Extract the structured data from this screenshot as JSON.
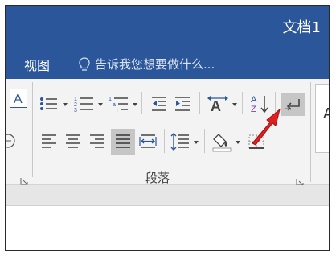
{
  "window": {
    "title": "文档1"
  },
  "tabs": {
    "view_label": "视图"
  },
  "tell_me": {
    "placeholder": "告诉我您想要做什么..."
  },
  "ribbon": {
    "paragraph_group_label": "段落",
    "style_preview_letter": "A"
  },
  "icons": {
    "bulb": "lightbulb-icon",
    "bullets": "bullets-icon",
    "numbering": "numbering-icon",
    "multilevel": "multilevel-list-icon",
    "decrease_indent": "decrease-indent-icon",
    "increase_indent": "increase-indent-icon",
    "char_scale": "character-scaling-icon",
    "sort": "sort-icon",
    "show_marks": "show-formatting-marks-icon",
    "align_left": "align-left-icon",
    "center": "align-center-icon",
    "align_right": "align-right-icon",
    "justify": "justify-icon",
    "distributed": "distributed-align-icon",
    "line_spacing": "line-spacing-icon",
    "shading": "shading-icon",
    "borders": "borders-icon",
    "red_pointer": "red-arrow-annotation"
  },
  "colors": {
    "ribbon_blue": "#2b579a",
    "ribbon_body": "#f3f3f3",
    "pressed_button": "#c6c6c6",
    "annotation_red": "#e02020"
  },
  "state": {
    "justify_pressed": true,
    "show_marks_highlighted": true
  }
}
